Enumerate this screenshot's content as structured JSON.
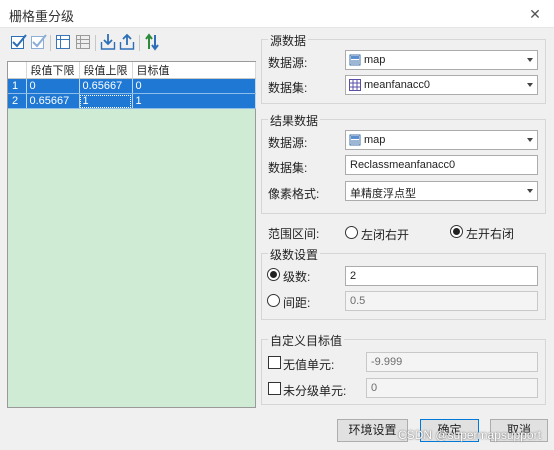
{
  "window": {
    "title": "栅格重分级",
    "close": "✕"
  },
  "toolbar": {
    "icons": [
      "check-all-icon",
      "uncheck-all-icon",
      "insert-row-icon",
      "delete-row-icon",
      "import-icon",
      "export-icon",
      "reverse-order-icon"
    ]
  },
  "table": {
    "columns": [
      "段值下限",
      "段值上限",
      "目标值"
    ],
    "rows": [
      {
        "no": "1",
        "lower": "0",
        "upper": "0.65667",
        "target": "0"
      },
      {
        "no": "2",
        "lower": "0.65667",
        "upper": "1",
        "target": "1"
      }
    ]
  },
  "source": {
    "group": "源数据",
    "ds_label": "数据源:",
    "ds_value": "map",
    "dataset_label": "数据集:",
    "dataset_value": "meanfanacc0"
  },
  "result": {
    "group": "结果数据",
    "ds_label": "数据源:",
    "ds_value": "map",
    "dataset_label": "数据集:",
    "dataset_value": "Reclassmeanfanacc0",
    "pixel_label": "像素格式:",
    "pixel_value": "单精度浮点型"
  },
  "range": {
    "label": "范围区间:",
    "opt1": "左闭右开",
    "opt2": "左开右闭",
    "selected": "opt2"
  },
  "levels": {
    "group": "级数设置",
    "count_label": "级数:",
    "count_value": "2",
    "interval_label": "间距:",
    "interval_value": "0.5"
  },
  "custom": {
    "group": "自定义目标值",
    "nodata_label": "无值单元:",
    "nodata_value": "-9.999",
    "unclass_label": "未分级单元:",
    "unclass_value": "0"
  },
  "buttons": {
    "env": "环境设置",
    "ok": "确定",
    "cancel": "取消"
  },
  "watermark": "CSDN @supermapsupport",
  "colors": {
    "selection": "#1e78d4",
    "grid_bg": "#d0ebd4",
    "accent": "#0078d7"
  }
}
